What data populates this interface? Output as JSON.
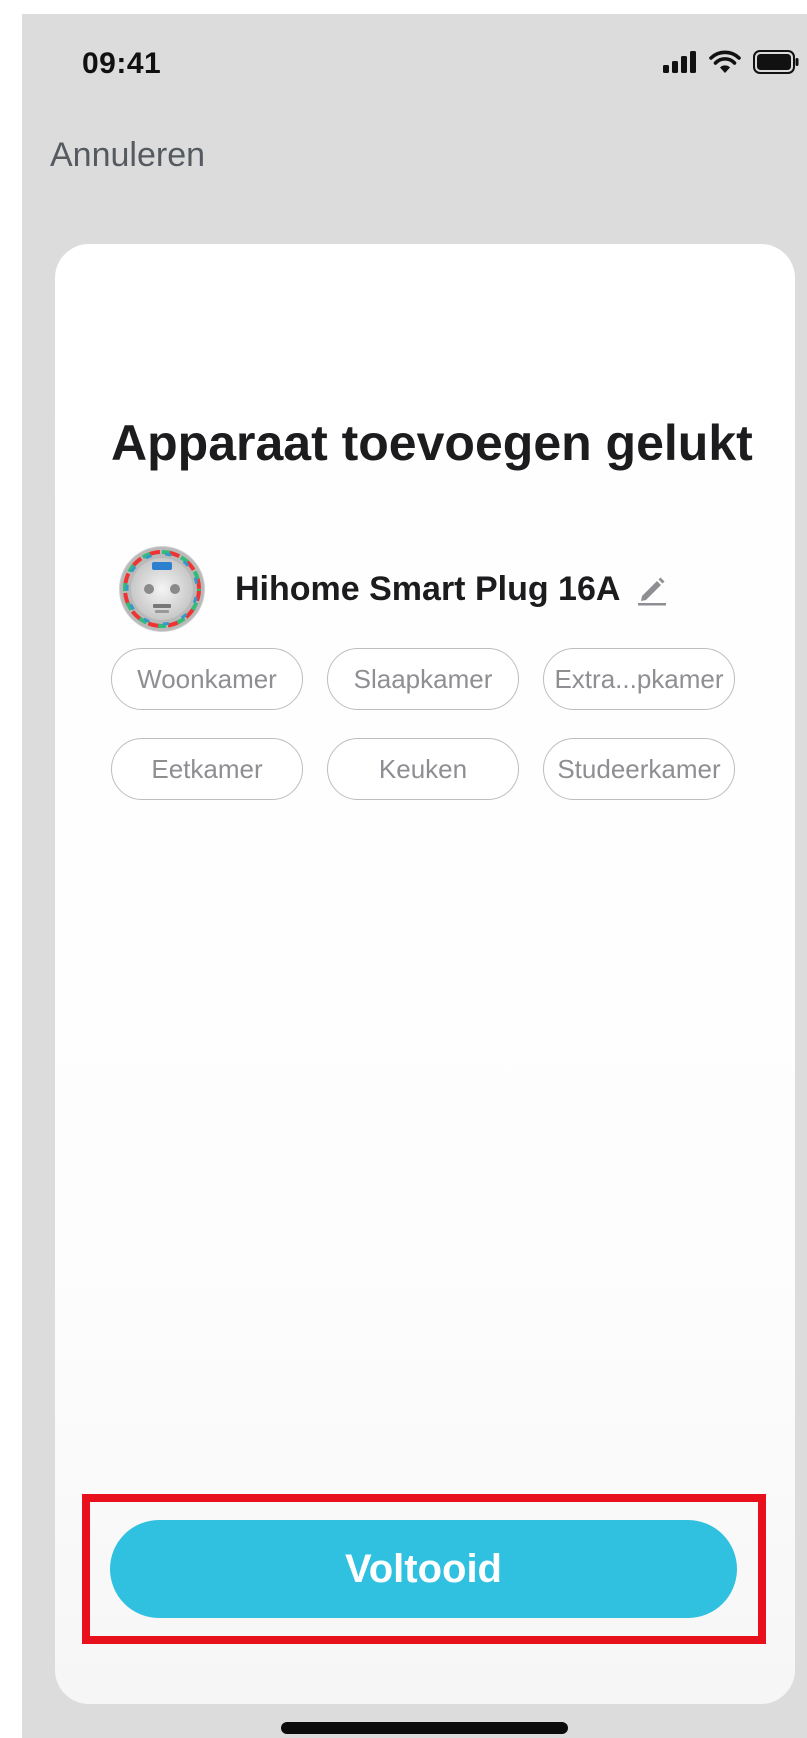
{
  "status_bar": {
    "time": "09:41",
    "icons": [
      "signal-icon",
      "wifi-icon",
      "battery-icon"
    ]
  },
  "nav": {
    "cancel_label": "Annuleren"
  },
  "card": {
    "title": "Apparaat toevoegen gelukt",
    "device": {
      "name": "Hihome Smart Plug 16A",
      "image_icon": "smart-plug-icon",
      "edit_icon": "pencil-icon"
    },
    "rooms": [
      "Woonkamer",
      "Slaapkamer",
      "Extra...pkamer",
      "Eetkamer",
      "Keuken",
      "Studeerkamer"
    ]
  },
  "actions": {
    "done_label": "Voltooid"
  },
  "colors": {
    "accent": "#31c1e0",
    "highlight": "#e8101c",
    "background": "#dcdcdc"
  }
}
